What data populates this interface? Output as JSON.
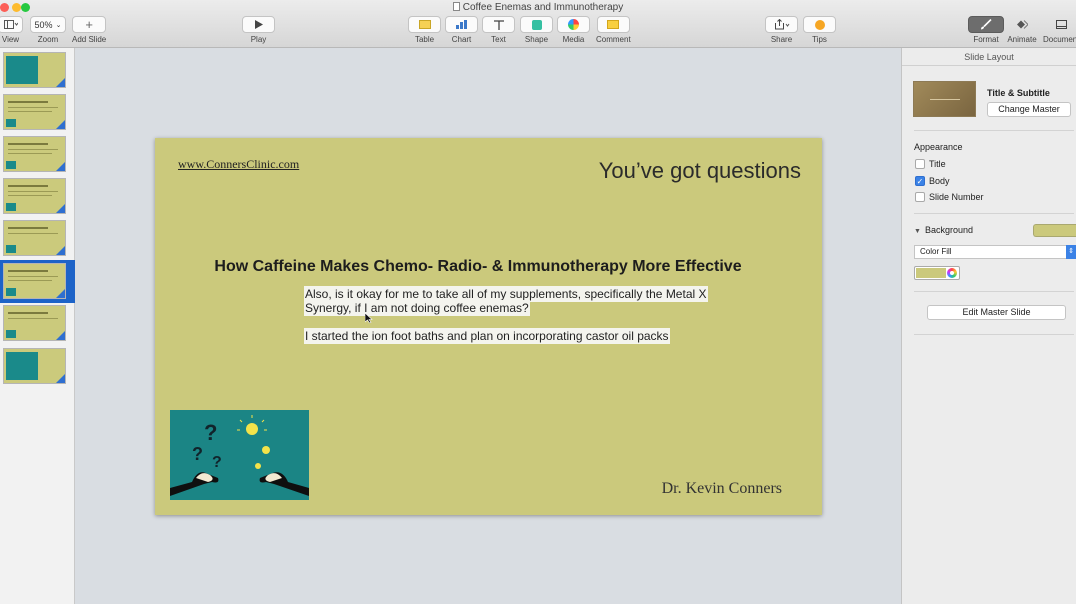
{
  "window": {
    "title": "Coffee Enemas and Immunotherapy"
  },
  "toolbar": {
    "view_label": "View",
    "zoom_value": "50%",
    "zoom_label": "Zoom",
    "add_slide_label": "Add Slide",
    "play_label": "Play",
    "table_label": "Table",
    "chart_label": "Chart",
    "text_label": "Text",
    "shape_label": "Shape",
    "media_label": "Media",
    "comment_label": "Comment",
    "share_label": "Share",
    "tips_label": "Tips",
    "format_label": "Format",
    "animate_label": "Animate",
    "document_label": "Document"
  },
  "navigator": {
    "slide_count": 8,
    "selected_index": 6
  },
  "slide": {
    "url": "www.ConnersClinic.com",
    "heading": "You’ve got questions",
    "title": "How Caffeine Makes Chemo- Radio- & Immunotherapy More Effective",
    "body_line1a": "Also, is it okay for me to take all of my supplements, specifically the Metal X",
    "body_line1b": "Synergy, if I am not doing coffee enemas?",
    "body_line2": "I started the ion foot baths and plan on incorporating castor oil packs",
    "signature": "Dr. Kevin Conners",
    "image_icon": "question-marks-lightbulbs-illustration"
  },
  "inspector": {
    "header": "Slide Layout",
    "master_name": "Title & Subtitle",
    "change_master": "Change Master",
    "appearance_label": "Appearance",
    "checkboxes": [
      {
        "label": "Title",
        "checked": false
      },
      {
        "label": "Body",
        "checked": true
      },
      {
        "label": "Slide Number",
        "checked": false
      }
    ],
    "background_label": "Background",
    "fill_type": "Color Fill",
    "fill_color": "#cbc97c",
    "edit_master": "Edit Master Slide"
  },
  "colors": {
    "slide_bg": "#cbc97c",
    "selection": "#1d63c8",
    "accent": "#3b82e6"
  }
}
